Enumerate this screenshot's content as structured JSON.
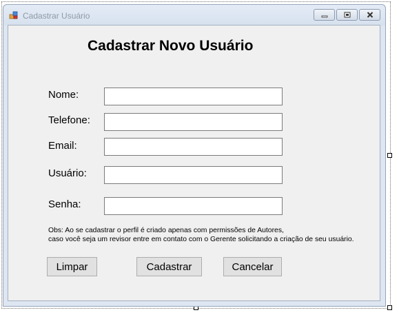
{
  "window": {
    "title": "Cadastrar Usuário",
    "icon": "app-form-icon",
    "controls": [
      "minimize",
      "maximize",
      "close"
    ]
  },
  "form": {
    "heading": "Cadastrar Novo Usuário",
    "fields": {
      "nome": {
        "label": "Nome:",
        "value": ""
      },
      "telefone": {
        "label": "Telefone:",
        "value": ""
      },
      "email": {
        "label": "Email:",
        "value": ""
      },
      "usuario": {
        "label": "Usuário:",
        "value": ""
      },
      "senha": {
        "label": "Senha:",
        "value": ""
      }
    },
    "note_line1": "Obs: Ao se cadastrar o perfil é criado apenas com permissões de Autores,",
    "note_line2": "caso você seja um revisor entre em contato com o Gerente solicitando a criação de seu usuário.",
    "buttons": {
      "limpar": "Limpar",
      "cadastrar": "Cadastrar",
      "cancelar": "Cancelar"
    }
  }
}
